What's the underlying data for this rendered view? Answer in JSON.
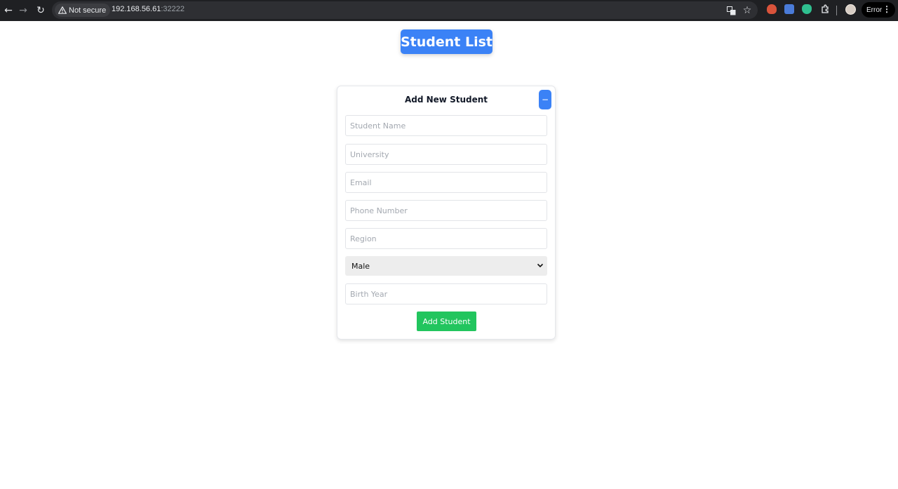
{
  "browser": {
    "security_label": "Not secure",
    "url_host": "192.168.56.61",
    "url_port": ":32222",
    "profile_status": "Error"
  },
  "page": {
    "title": "Student List"
  },
  "form": {
    "title": "Add New Student",
    "collapse_label": "−",
    "fields": {
      "name_placeholder": "Student Name",
      "university_placeholder": "University",
      "email_placeholder": "Email",
      "phone_placeholder": "Phone Number",
      "region_placeholder": "Region",
      "birth_year_placeholder": "Birth Year"
    },
    "gender": {
      "selected": "Male"
    },
    "submit_label": "Add Student"
  },
  "colors": {
    "primary": "#3b82f6",
    "success": "#22c55e",
    "chrome_bg": "#1f2023"
  },
  "icons": [
    "back-arrow-icon",
    "forward-arrow-icon",
    "reload-icon",
    "warning-icon",
    "translate-icon",
    "star-icon",
    "extensions-icon",
    "chevron-down-icon"
  ]
}
